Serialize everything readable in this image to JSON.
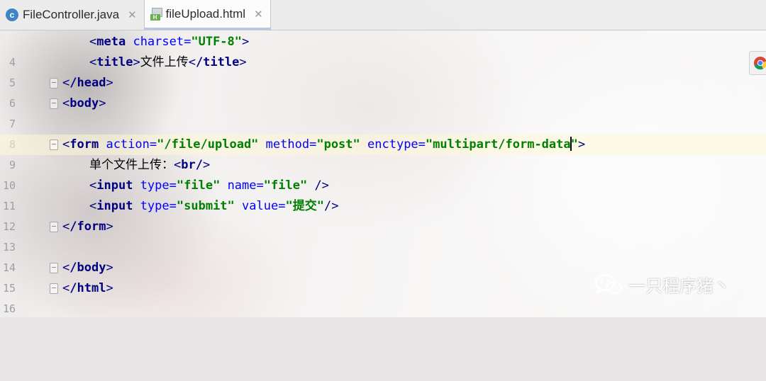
{
  "tabs": [
    {
      "label": "FileController.java",
      "icon": "java-class-icon",
      "active": false
    },
    {
      "label": "fileUpload.html",
      "icon": "html-file-icon",
      "active": true
    }
  ],
  "lines": [
    {
      "number": "4"
    },
    {
      "number": "5"
    },
    {
      "number": "6"
    },
    {
      "number": "7"
    },
    {
      "number": "8"
    },
    {
      "number": "9"
    },
    {
      "number": "10"
    },
    {
      "number": "11"
    },
    {
      "number": "12"
    },
    {
      "number": "13"
    },
    {
      "number": "14"
    },
    {
      "number": "15"
    },
    {
      "number": "16"
    }
  ],
  "code": {
    "l4": {
      "tag": "meta",
      "attr1": "charset",
      "val1": "\"UTF-8\""
    },
    "l5": {
      "tag": "title",
      "text": "文件上传",
      "close": "/title"
    },
    "l6": {
      "tag": "/head"
    },
    "l7": {
      "tag": "body"
    },
    "l9": {
      "tag": "form",
      "attr1": "action",
      "val1": "\"/file/upload\"",
      "attr2": "method",
      "val2": "\"post\"",
      "attr3": "enctype",
      "val3a": "\"multipart/form-data",
      "val3b": "\""
    },
    "l10": {
      "text": "单个文件上传：",
      "tag": "br/"
    },
    "l11": {
      "tag": "input",
      "attr1": "type",
      "val1": "\"file\"",
      "attr2": "name",
      "val2": "\"file\"",
      "end": "/>"
    },
    "l12": {
      "tag": "input",
      "attr1": "type",
      "val1": "\"submit\"",
      "attr2": "value",
      "val2": "\"提交\"",
      "end": "/>"
    },
    "l13": {
      "tag": "/form"
    },
    "l15": {
      "tag": "/body"
    },
    "l16": {
      "tag": "/html"
    }
  },
  "sidebar": {
    "browser_icon": "chrome-icon"
  },
  "watermark": {
    "text": "一只程序猪丶",
    "icon": "wechat-icon"
  },
  "colors": {
    "tag": "#000080",
    "attribute": "#0000ff",
    "value": "#008000",
    "line_number": "#9aa0a6",
    "current_line": "#fdf8d6"
  }
}
